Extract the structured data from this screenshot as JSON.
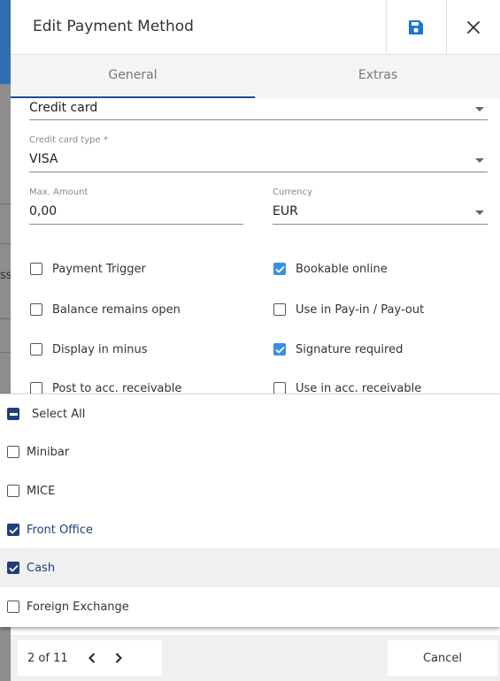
{
  "dialog": {
    "title": "Edit Payment Method",
    "tabs": [
      {
        "label": "General",
        "active": true
      },
      {
        "label": "Extras",
        "active": false
      }
    ]
  },
  "form": {
    "payment_type": {
      "value": "Credit card"
    },
    "card_type": {
      "label": "Credit card type *",
      "value": "VISA"
    },
    "max_amount": {
      "label": "Max. Amount",
      "value": "0,00"
    },
    "currency": {
      "label": "Currency",
      "value": "EUR"
    }
  },
  "checkboxes": {
    "left": [
      {
        "label": "Payment Trigger",
        "checked": false
      },
      {
        "label": "Balance remains open",
        "checked": false
      },
      {
        "label": "Display in minus",
        "checked": false
      },
      {
        "label": "Post to acc. receivable",
        "checked": false
      }
    ],
    "right": [
      {
        "label": "Bookable online",
        "checked": true
      },
      {
        "label": "Use in Pay-in / Pay-out",
        "checked": false
      },
      {
        "label": "Signature required",
        "checked": true
      },
      {
        "label": "Use in acc. receivable",
        "checked": false
      }
    ]
  },
  "dropdown": {
    "select_all": {
      "label": "Select All",
      "state": "indeterminate"
    },
    "options": [
      {
        "label": "Minibar",
        "checked": false
      },
      {
        "label": "MICE",
        "checked": false
      },
      {
        "label": "Front Office",
        "checked": true
      },
      {
        "label": "Cash",
        "checked": true,
        "highlighted": true
      },
      {
        "label": "Foreign Exchange",
        "checked": false
      }
    ]
  },
  "footer": {
    "pager_text": "2 of 11",
    "cancel_label": "Cancel"
  },
  "background": {
    "clipped_text": "ss"
  },
  "colors": {
    "accent_dark": "#1e3f7a",
    "accent_light": "#3a8fe0",
    "save_icon": "#1976d2",
    "tab_underline": "#1e4d8f"
  }
}
